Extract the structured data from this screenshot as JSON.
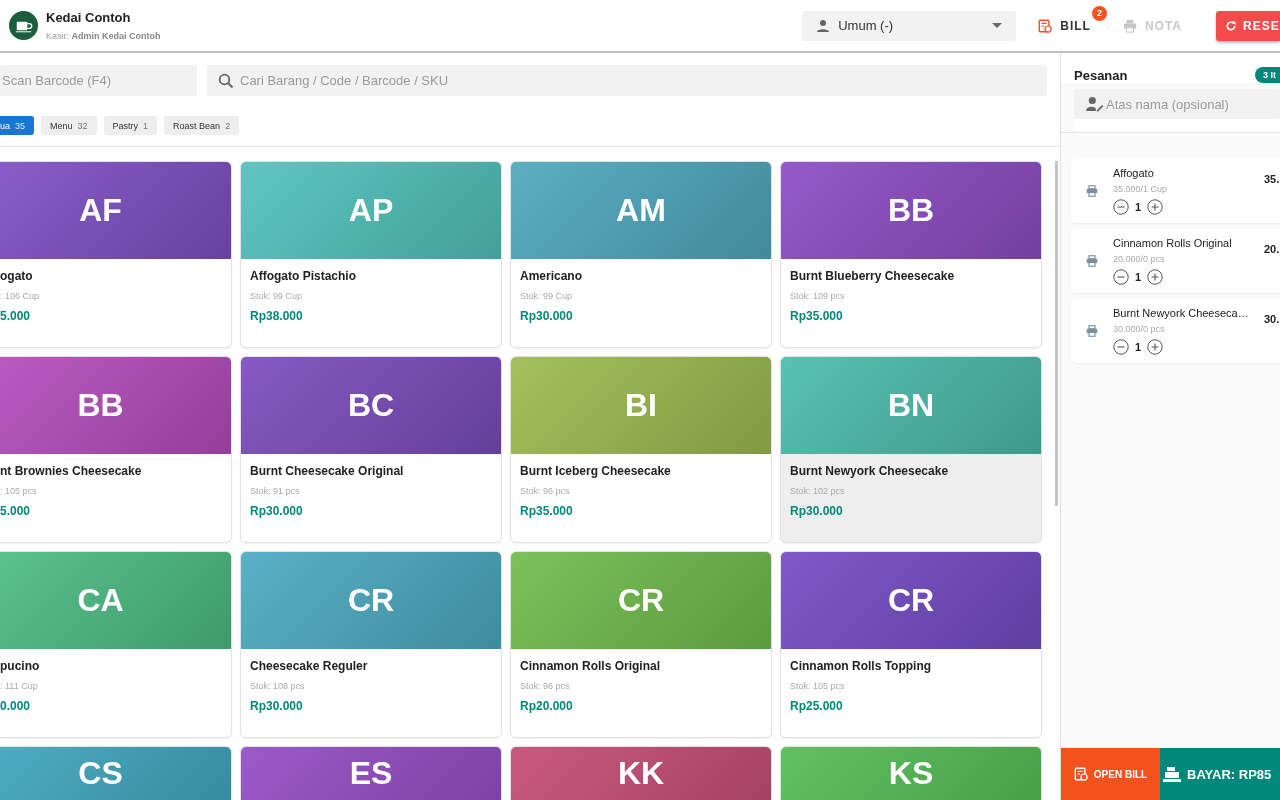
{
  "header": {
    "store_name": "Kedai Contoh",
    "cashier": "Kasir: **Admin Kedai Contoh**",
    "customer": "Umum (-)",
    "bill": {
      "label": "BILL",
      "badge": "2",
      "disabled": false
    },
    "nota": {
      "label": "NOTA",
      "disabled": true
    },
    "reset": "RESE"
  },
  "scan": {
    "placeholder": "Scan Barcode (F4)"
  },
  "search": {
    "placeholder": "Cari Barang / Code / Barcode / SKU"
  },
  "categories": [
    {
      "label": "ua",
      "count": "35",
      "selected": true
    },
    {
      "label": "Menu",
      "count": "32",
      "selected": false
    },
    {
      "label": "Pastry",
      "count": "1",
      "selected": false
    },
    {
      "label": "Roast Bean",
      "count": "2",
      "selected": false
    }
  ],
  "products": [
    {
      "initials": "AF",
      "name": "ogato",
      "stock": ": 106 Cup",
      "price": "5.000",
      "color": "#7e4fc4",
      "selected": false
    },
    {
      "initials": "AP",
      "name": "Affogato Pistachio",
      "stock": "Stok: 99 Cup",
      "price": "Rp38.000",
      "color": "#52c2bb",
      "selected": false
    },
    {
      "initials": "AM",
      "name": "Americano",
      "stock": "Stok: 99 Cup",
      "price": "Rp30.000",
      "color": "#4ea8bd",
      "selected": false
    },
    {
      "initials": "BB",
      "name": "Burnt Blueberry Cheesecake",
      "stock": "Stok: 109 pcs",
      "price": "Rp35.000",
      "color": "#8c4cc4",
      "selected": false
    },
    {
      "initials": "BB",
      "name": "nt Brownies Cheesecake",
      "stock": ": 105 pcs",
      "price": "5.000",
      "color": "#b44cbc",
      "selected": false
    },
    {
      "initials": "BC",
      "name": "Burnt Cheesecake Original",
      "stock": "Stok: 91 pcs",
      "price": "Rp30.000",
      "color": "#7c4cbc",
      "selected": false
    },
    {
      "initials": "BI",
      "name": "Burnt Iceberg Cheesecake",
      "stock": "Stok: 96 pcs",
      "price": "Rp35.000",
      "color": "#9cbc50",
      "selected": false
    },
    {
      "initials": "BN",
      "name": "Burnt Newyork Cheesecake",
      "stock": "Stok: 102 pcs",
      "price": "Rp30.000",
      "color": "#4cbcaa",
      "selected": true
    },
    {
      "initials": "CA",
      "name": "pucino",
      "stock": ": 111 Cup",
      "price": "0.000",
      "color": "#4cbc84",
      "selected": false
    },
    {
      "initials": "CR",
      "name": "Cheesecake Reguler",
      "stock": "Stok: 108 pcs",
      "price": "Rp30.000",
      "color": "#4caac2",
      "selected": false
    },
    {
      "initials": "CR",
      "name": "Cinnamon Rolls Original",
      "stock": "Stok: 96 pcs",
      "price": "Rp20.000",
      "color": "#70bc4c",
      "selected": false
    },
    {
      "initials": "CR",
      "name": "Cinnamon Rolls Topping",
      "stock": "Stok: 105 pcs",
      "price": "Rp25.000",
      "color": "#744cc4",
      "selected": false
    },
    {
      "initials": "CS",
      "color": "#3ea4bc"
    },
    {
      "initials": "ES",
      "color": "#944cc4"
    },
    {
      "initials": "KK",
      "color": "#c44c74"
    },
    {
      "initials": "KS",
      "color": "#54bc54"
    }
  ],
  "order": {
    "title": "Pesanan",
    "badge": "3 It",
    "name_field": {
      "placeholder": "Atas nama (opsional)"
    },
    "items": [
      {
        "name": "Affogato",
        "unit": "35.000/1 Cup",
        "qty": "1",
        "total": "35."
      },
      {
        "name": "Cinnamon Rolls Original",
        "unit": "20.000/0 pcs",
        "qty": "1",
        "total": "20."
      },
      {
        "name": "Burnt Newyork Cheeseca…",
        "unit": "30.000/0 pcs",
        "qty": "1",
        "total": "30."
      }
    ],
    "open_bill": "OPEN BILL",
    "pay": "BAYAR: RP85"
  }
}
